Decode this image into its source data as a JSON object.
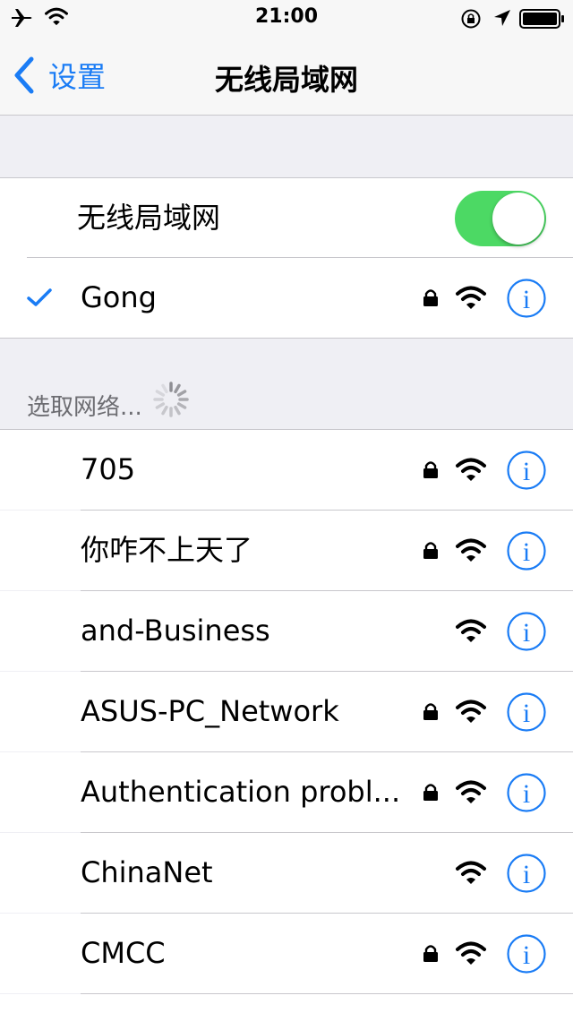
{
  "status": {
    "time": "21:00"
  },
  "nav": {
    "back_label": "设置",
    "title": "无线局域网"
  },
  "wifi_toggle": {
    "label": "无线局域网",
    "on": true
  },
  "connected": {
    "name": "Gong",
    "locked": true
  },
  "section_header": "选取网络...",
  "networks": [
    {
      "name": "705",
      "locked": true
    },
    {
      "name": "你咋不上天了",
      "locked": true
    },
    {
      "name": "and-Business",
      "locked": false
    },
    {
      "name": "ASUS-PC_Network",
      "locked": true
    },
    {
      "name": "Authentication  probl...",
      "locked": true
    },
    {
      "name": "ChinaNet",
      "locked": false
    },
    {
      "name": "CMCC",
      "locked": true
    }
  ],
  "colors": {
    "accent": "#1a7cf5",
    "toggle_on": "#4cd964",
    "background": "#efeff4",
    "separator": "#c8c7cc"
  },
  "icons": [
    "airplane-icon",
    "wifi-icon",
    "rotation-lock-icon",
    "location-arrow-icon",
    "battery-icon",
    "chevron-left-icon",
    "checkmark-icon",
    "lock-icon",
    "info-icon",
    "spinner-icon"
  ]
}
